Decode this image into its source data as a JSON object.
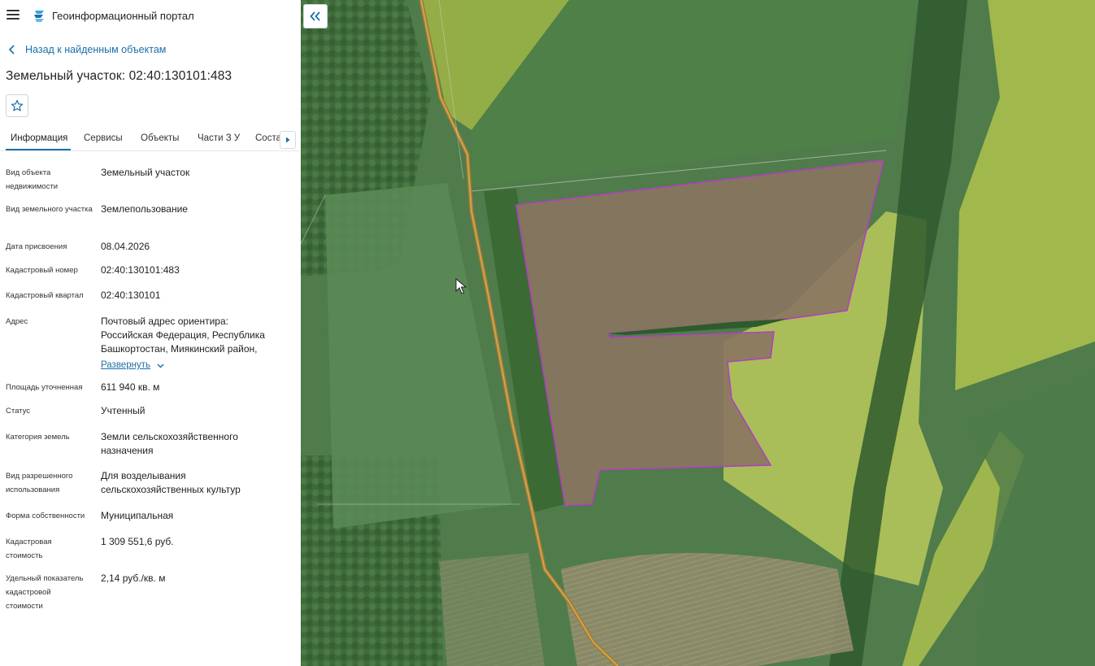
{
  "header": {
    "app_title": "Геоинформационный портал"
  },
  "nav": {
    "back_label": "Назад к найденным объектам"
  },
  "object": {
    "title": "Земельный участок: 02:40:130101:483"
  },
  "tabs": [
    {
      "label": "Информация",
      "active": true
    },
    {
      "label": "Сервисы",
      "active": false
    },
    {
      "label": "Объекты",
      "active": false
    },
    {
      "label": "Части З У",
      "active": false
    },
    {
      "label": "Состав",
      "active": false
    }
  ],
  "info": {
    "object_type": {
      "label": "Вид объекта недвижимости",
      "value": "Земельный участок"
    },
    "land_type": {
      "label": "Вид земельного участка",
      "value": "Землепользование"
    },
    "date_assigned": {
      "label": "Дата присвоения",
      "value": "08.04.2026"
    },
    "cadastral_number": {
      "label": "Кадастровый номер",
      "value": "02:40:130101:483"
    },
    "cadastral_quarter": {
      "label": "Кадастровый квартал",
      "value": "02:40:130101"
    },
    "address": {
      "label": "Адрес",
      "line1": "Почтовый адрес ориентира:",
      "line2": "Российская Федерация, Республика",
      "line3": "Башкортостан, Миякинский район,",
      "expand_label": "Развернуть"
    },
    "area": {
      "label": "Площадь уточненная",
      "value": "611 940 кв. м"
    },
    "status": {
      "label": "Статус",
      "value": "Учтенный"
    },
    "land_category": {
      "label": "Категория земель",
      "line1": "Земли сельскохозяйственного",
      "line2": "назначения"
    },
    "permitted_use": {
      "label_line1": "Вид разрешенного",
      "label_line2": "использования",
      "line1": "Для возделывания",
      "line2": "сельскохозяйственных культур"
    },
    "ownership": {
      "label": "Форма собственности",
      "value": "Муниципальная"
    },
    "cadastral_value": {
      "label_line1": "Кадастровая",
      "label_line2": "стоимость",
      "value": "1 309 551,6 руб."
    },
    "specific_value": {
      "label_line1": "Удельный показатель",
      "label_line2": "кадастровой",
      "label_line3": "стоимости",
      "value": "2,14 руб./кв. м"
    }
  },
  "icons": {
    "menu": "menu-icon",
    "logo": "portal-logo-icon",
    "back": "chevron-left-icon",
    "favorite": "star-icon",
    "tabs_next": "chevron-right-icon",
    "collapse": "double-chevron-left-icon",
    "expand": "chevron-down-icon"
  },
  "colors": {
    "link": "#1b6fa8",
    "parcel_outline": "#b43cc8",
    "parcel_fill": "#8a7460"
  }
}
